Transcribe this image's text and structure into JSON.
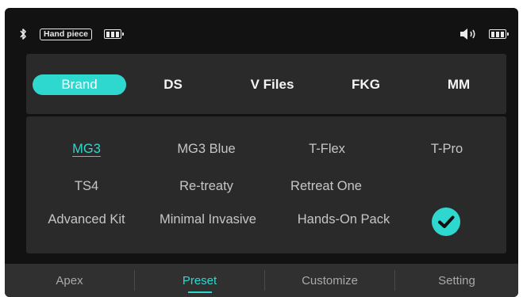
{
  "status_bar": {
    "bluetooth_icon": "bluetooth-icon",
    "device_label": "Hand piece",
    "volume_icon": "speaker-volume-icon",
    "battery_icon": "battery-icon"
  },
  "brands": [
    {
      "label": "Brand",
      "active": true
    },
    {
      "label": "DS",
      "active": false
    },
    {
      "label": "V Files",
      "active": false
    },
    {
      "label": "FKG",
      "active": false
    },
    {
      "label": "MM",
      "active": false
    }
  ],
  "presets": [
    {
      "label": "MG3",
      "selected": true
    },
    {
      "label": "MG3 Blue",
      "selected": false
    },
    {
      "label": "T-Flex",
      "selected": false
    },
    {
      "label": "T-Pro",
      "selected": false
    },
    {
      "label": "TS4",
      "selected": false
    },
    {
      "label": "Re-treaty",
      "selected": false
    },
    {
      "label": "Retreat One",
      "selected": false
    },
    {
      "label": "Advanced Kit",
      "selected": false
    },
    {
      "label": "Minimal Invasive",
      "selected": false
    },
    {
      "label": "Hands-On Pack",
      "selected": false
    }
  ],
  "confirm_icon": "checkmark-icon",
  "tabs": [
    {
      "label": "Apex",
      "active": false
    },
    {
      "label": "Preset",
      "active": true
    },
    {
      "label": "Customize",
      "active": false
    },
    {
      "label": "Setting",
      "active": false
    }
  ],
  "colors": {
    "accent": "#2ed8cf",
    "background": "#121212",
    "panel": "#2a2a2a",
    "tabbar": "#303030"
  }
}
